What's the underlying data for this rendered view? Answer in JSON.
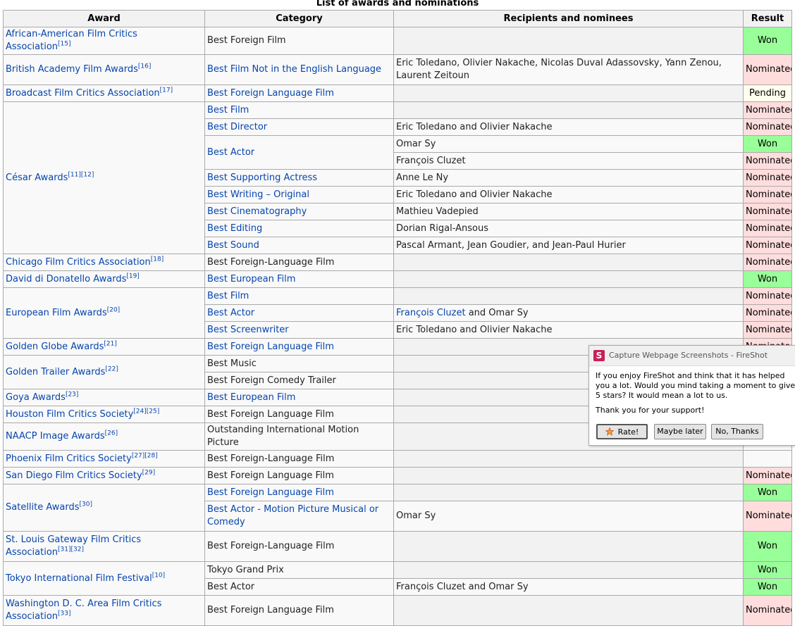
{
  "caption": "List of awards and nominations",
  "headers": {
    "award": "Award",
    "category": "Category",
    "recipients": "Recipients and nominees",
    "result": "Result"
  },
  "rows": {
    "r1": {
      "award": "African-American Film Critics Association",
      "award_ref": "[15]",
      "category": "Best Foreign Film",
      "result": "Won"
    },
    "r2": {
      "award": "British Academy Film Awards",
      "award_ref": "[16]",
      "category": "Best Film Not in the English Language",
      "recipients": "Eric Toledano, Olivier Nakache, Nicolas Duval Adassovsky, Yann Zenou, Laurent Zeitoun",
      "result": "Nominated"
    },
    "r3": {
      "award": "Broadcast Film Critics Association",
      "award_ref": "[17]",
      "category": "Best Foreign Language Film",
      "result": "Pending"
    },
    "cesar": {
      "award": "César Awards",
      "award_ref": "[11][12]",
      "c1": {
        "category": "Best Film",
        "result": "Nominated"
      },
      "c2": {
        "category": "Best Director",
        "recipients": "Eric Toledano and Olivier Nakache",
        "result": "Nominated"
      },
      "c3": {
        "category": "Best Actor",
        "recipients": "Omar Sy",
        "result": "Won"
      },
      "c4": {
        "recipients": "François Cluzet",
        "result": "Nominated"
      },
      "c5": {
        "category": "Best Supporting Actress",
        "recipients": "Anne Le Ny",
        "result": "Nominated"
      },
      "c6": {
        "category": "Best Writing – Original",
        "recipients": "Eric Toledano and Olivier Nakache",
        "result": "Nominated"
      },
      "c7": {
        "category": "Best Cinematography",
        "recipients": "Mathieu Vadepied",
        "result": "Nominated"
      },
      "c8": {
        "category": "Best Editing",
        "recipients": "Dorian Rigal-Ansous",
        "result": "Nominated"
      },
      "c9": {
        "category": "Best Sound",
        "recipients": "Pascal Armant, Jean Goudier, and Jean-Paul Hurier",
        "result": "Nominated"
      }
    },
    "r4": {
      "award": "Chicago Film Critics Association",
      "award_ref": "[18]",
      "category": "Best Foreign-Language Film",
      "result": "Nominated"
    },
    "r5": {
      "award": "David di Donatello Awards",
      "award_ref": "[19]",
      "category": "Best European Film",
      "result": "Won"
    },
    "efa": {
      "award": "European Film Awards",
      "award_ref": "[20]",
      "e1": {
        "category": "Best Film",
        "result": "Nominated"
      },
      "e2": {
        "category": "Best Actor",
        "recipient_a": "François Cluzet",
        "recipient_and": " and ",
        "recipient_b": "Omar Sy",
        "result": "Nominated"
      },
      "e3": {
        "category": "Best Screenwriter",
        "recipients": "Eric Toledano and Olivier Nakache",
        "result": "Nominated"
      }
    },
    "r6": {
      "award": "Golden Globe Awards",
      "award_ref": "[21]",
      "category": "Best Foreign Language Film",
      "result": "Nominated"
    },
    "gta": {
      "award": "Golden Trailer Awards",
      "award_ref": "[22]",
      "g1": {
        "category": "Best Music"
      },
      "g2": {
        "category": "Best Foreign Comedy Trailer"
      }
    },
    "r7": {
      "award": "Goya Awards",
      "award_ref": "[23]",
      "category": "Best European Film"
    },
    "r8": {
      "award": "Houston Film Critics Society",
      "award_ref": "[24][25]",
      "category": "Best Foreign Language Film"
    },
    "r9": {
      "award": "NAACP Image Awards",
      "award_ref": "[26]",
      "category": "Outstanding International Motion Picture"
    },
    "r10": {
      "award": "Phoenix Film Critics Society",
      "award_ref": "[27][28]",
      "category": "Best Foreign-Language Film"
    },
    "r11": {
      "award": "San Diego Film Critics Society",
      "award_ref": "[29]",
      "category": "Best Foreign Language Film",
      "result": "Nominated"
    },
    "sat": {
      "award": "Satellite Awards",
      "award_ref": "[30]",
      "s1": {
        "category": "Best Foreign Language Film",
        "result": "Won"
      },
      "s2": {
        "category": "Best Actor - Motion Picture Musical or Comedy",
        "recipients": "Omar Sy",
        "result": "Nominated"
      }
    },
    "r12": {
      "award": "St. Louis Gateway Film Critics Association",
      "award_ref": "[31][32]",
      "category": "Best Foreign-Language Film",
      "result": "Won"
    },
    "tiff": {
      "award": "Tokyo International Film Festival",
      "award_ref": "[10]",
      "t1": {
        "category": "Tokyo Grand Prix",
        "result": "Won"
      },
      "t2": {
        "category": "Best Actor",
        "recipients": "François Cluzet and Omar Sy",
        "result": "Won"
      }
    },
    "r13": {
      "award": "Washington D. C. Area Film Critics Association",
      "award_ref": "[33]",
      "category": "Best Foreign Language Film",
      "result": "Nominated"
    }
  },
  "popup": {
    "icon_letter": "S",
    "title": "Capture Webpage Screenshots - FireShot",
    "message": "If you enjoy FireShot and think that it has helped\nyou a lot. Would you mind taking a moment to give\n5 stars? It would mean a lot to us.",
    "thanks": "Thank you for your support!",
    "rate_label": "Rate!",
    "later_label": "Maybe later",
    "no_label": "No, Thanks"
  },
  "colors": {
    "won": "#99ff99",
    "nominated": "#ffdddd",
    "pending": "#ffffee",
    "link": "#0645ad",
    "fireshot_brand": "#c8205a"
  }
}
